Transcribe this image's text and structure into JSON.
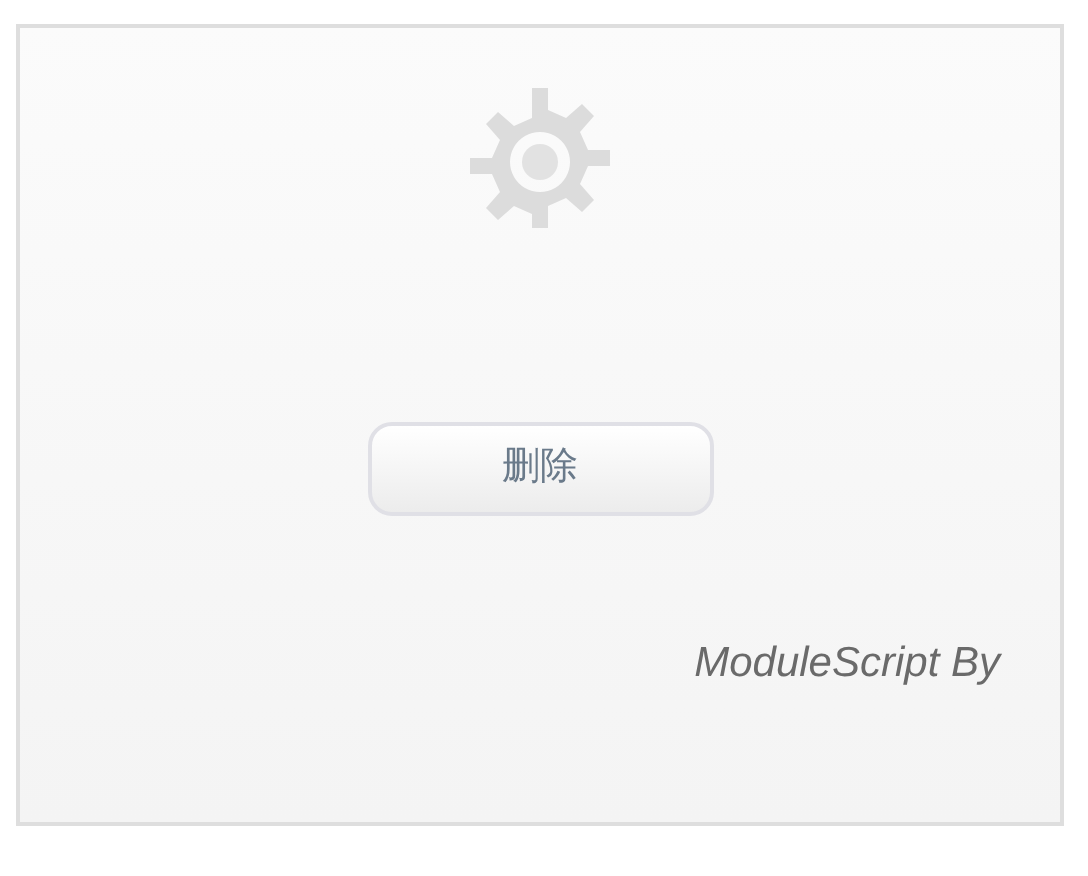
{
  "button": {
    "label": "删除"
  },
  "footer": {
    "text": "ModuleScript By"
  }
}
